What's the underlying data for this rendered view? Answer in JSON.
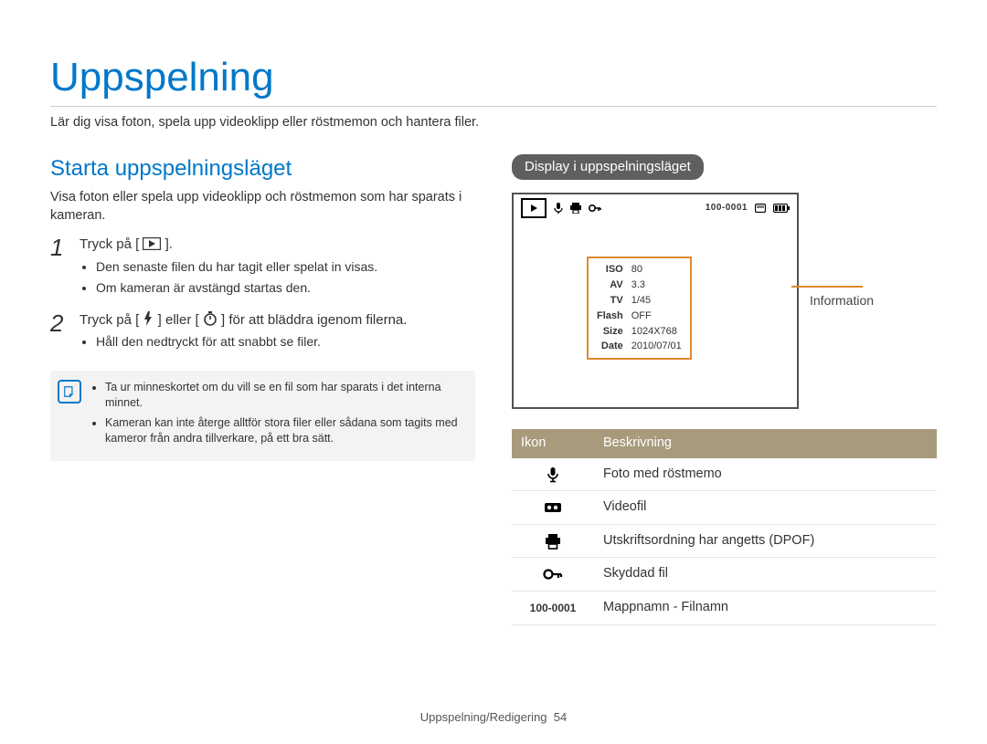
{
  "chapter": {
    "title": "Uppspelning",
    "subtitle": "Lär dig visa foton, spela upp videoklipp eller röstmemon och hantera filer."
  },
  "left": {
    "heading": "Starta uppspelningsläget",
    "intro": "Visa foton eller spela upp videoklipp och röstmemon som har sparats i kameran.",
    "step1_num": "1",
    "step1_pre": "Tryck på [",
    "step1_post": "].",
    "step1_bullets": [
      "Den senaste filen du har tagit eller spelat in visas.",
      "Om kameran är avstängd startas den."
    ],
    "step2_num": "2",
    "step2_pre": "Tryck på [",
    "step2_mid": "] eller [",
    "step2_post": "] för att bläddra igenom filerna.",
    "step2_bullets": [
      "Håll den nedtryckt för att snabbt se filer."
    ],
    "note": [
      "Ta ur minneskortet om du vill se en fil som har sparats i det interna minnet.",
      "Kameran kan inte återge alltför stora filer eller sådana som tagits med kameror från andra tillverkare, på ett bra sätt."
    ]
  },
  "right": {
    "heading": "Display i uppspelningsläget",
    "folder_file": "100-0001",
    "info_label": "Information",
    "info": {
      "ISO": "80",
      "AV": "3.3",
      "TV": "1/45",
      "Flash": "OFF",
      "Size": "1024X768",
      "Date": "2010/07/01"
    },
    "table": {
      "head": {
        "icon": "Ikon",
        "desc": "Beskrivning"
      },
      "rows": [
        {
          "desc": "Foto med röstmemo"
        },
        {
          "desc": "Videofil"
        },
        {
          "desc": "Utskriftsordning har angetts (DPOF)"
        },
        {
          "desc": "Skyddad fil"
        },
        {
          "desc": "Mappnamn - Filnamn"
        }
      ],
      "folder_file_text": "100-0001"
    }
  },
  "footer": {
    "section": "Uppspelning/Redigering",
    "page": "54"
  }
}
